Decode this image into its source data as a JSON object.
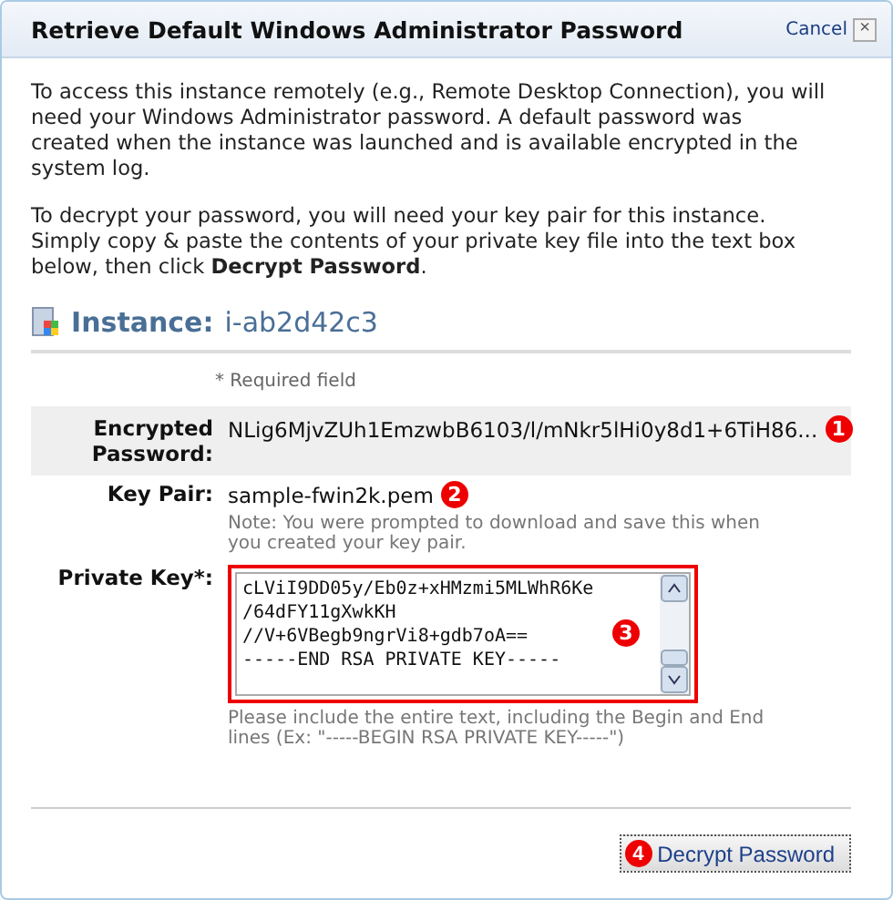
{
  "dialog": {
    "title": "Retrieve Default Windows Administrator Password",
    "cancel": "Cancel",
    "close": "×"
  },
  "intro": [
    "To access this instance remotely (e.g., Remote Desktop Connection), you will need your Windows Administrator password. A default password was created when the instance was launched and is available encrypted in the system log.",
    "To decrypt your password, you will need your key pair for this instance. Simply copy & paste the contents of your private key file into the text box below, then click **Decrypt Password**."
  ],
  "instance": {
    "label": "Instance:",
    "id": "i-ab2d42c3"
  },
  "required_note": "* Required field",
  "fields": [
    {
      "kind": "text",
      "label": "Encrypted Password:",
      "value": "NLig6MjvZUh1EmzwbB6103/l/mNkr5lHi0y8d1+6TiH86...",
      "shaded": true,
      "callout": "1"
    },
    {
      "kind": "text",
      "label": "Key Pair:",
      "value": "sample-fwin2k.pem",
      "shaded": false,
      "callout": "2",
      "note": "Note: You were prompted to download and save this when you created your key pair."
    },
    {
      "kind": "textarea",
      "label": "Private Key*:",
      "value": "cLViI9DD05y/Eb0z+xHMzmi5MLWhR6Ke\n/64dFY11gXwkKH\n//V+6VBegb9ngrVi8+gdb7oA==\n-----END RSA PRIVATE KEY-----",
      "shaded": false,
      "callout": "3",
      "note": "Please include the entire text, including the Begin and End lines (Ex: \"-----BEGIN RSA PRIVATE KEY-----\")"
    }
  ],
  "button": {
    "label": "Decrypt Password",
    "callout": "4"
  }
}
